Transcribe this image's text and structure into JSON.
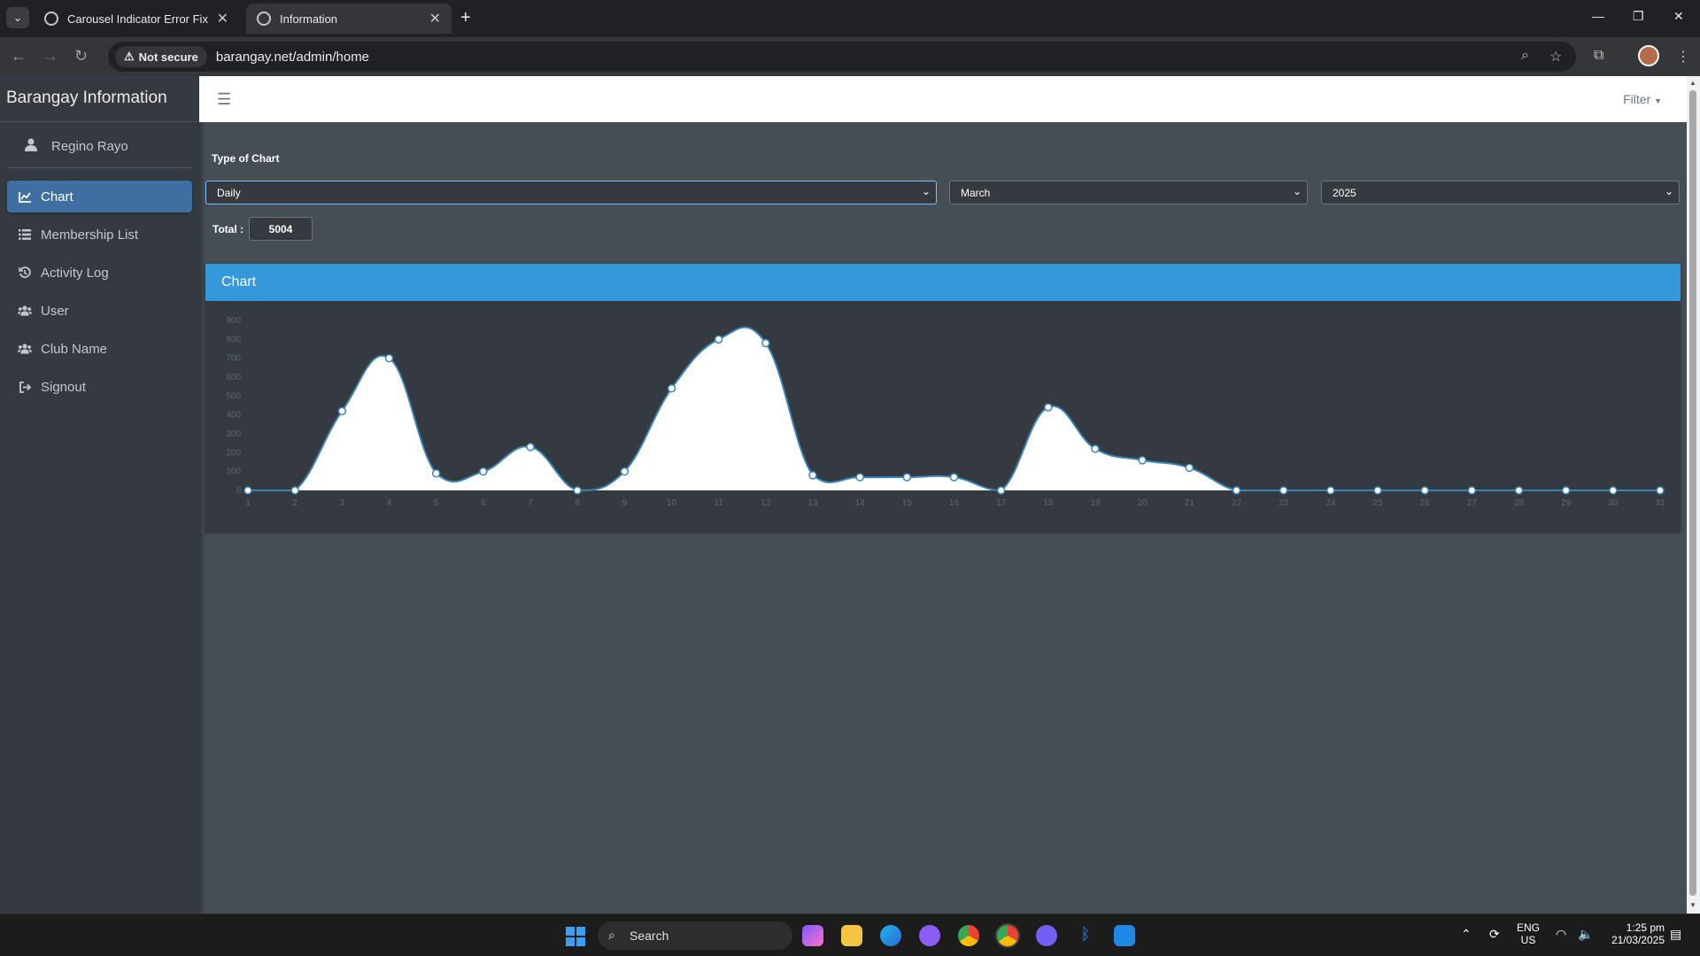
{
  "browser": {
    "tabs": [
      {
        "title": "Carousel Indicator Error Fix",
        "active": false
      },
      {
        "title": "Information",
        "active": true
      }
    ],
    "security_label": "Not secure",
    "url": "barangay.net/admin/home"
  },
  "sidebar": {
    "brand": "Barangay Information",
    "user_name": "Regino Rayo",
    "items": [
      {
        "label": "Chart",
        "icon": "chart-line-icon",
        "active": true
      },
      {
        "label": "Membership List",
        "icon": "list-icon",
        "active": false
      },
      {
        "label": "Activity Log",
        "icon": "history-icon",
        "active": false
      },
      {
        "label": "User",
        "icon": "users-icon",
        "active": false
      },
      {
        "label": "Club Name",
        "icon": "users-icon",
        "active": false
      },
      {
        "label": "Signout",
        "icon": "sign-out-icon",
        "active": false
      }
    ]
  },
  "topnav": {
    "filter_label": "Filter"
  },
  "controls": {
    "type_label": "Type of Chart",
    "type_value": "Daily",
    "month_value": "March",
    "year_value": "2025",
    "total_label": "Total :",
    "total_value": "5004"
  },
  "card": {
    "title": "Chart"
  },
  "chart_data": {
    "type": "area",
    "x": [
      "1",
      "2",
      "3",
      "4",
      "5",
      "6",
      "7",
      "8",
      "9",
      "10",
      "11",
      "12",
      "13",
      "14",
      "15",
      "16",
      "17",
      "18",
      "19",
      "20",
      "21",
      "22",
      "23",
      "24",
      "25",
      "26",
      "27",
      "28",
      "29",
      "30",
      "31"
    ],
    "values": [
      0,
      0,
      420,
      700,
      90,
      100,
      230,
      0,
      100,
      540,
      800,
      780,
      80,
      70,
      70,
      70,
      0,
      440,
      220,
      160,
      120,
      0,
      0,
      0,
      0,
      0,
      0,
      0,
      0,
      0,
      0
    ],
    "ylim": [
      0,
      900
    ],
    "yticks": [
      "0",
      "100",
      "200",
      "300",
      "400",
      "500",
      "600",
      "700",
      "800",
      "900"
    ],
    "colors": {
      "fill": "#ffffff",
      "line": "#3a83b5",
      "point": "#ffffff"
    }
  },
  "taskbar": {
    "search_label": "Search",
    "lang_top": "ENG",
    "lang_bottom": "US",
    "time": "1:25 pm",
    "date": "21/03/2025"
  }
}
